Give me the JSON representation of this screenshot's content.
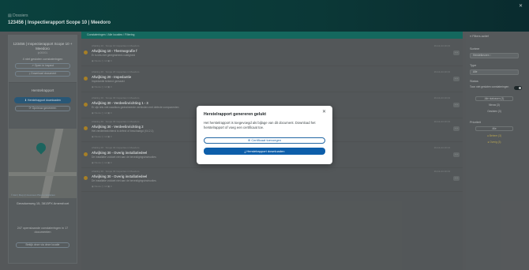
{
  "header": {
    "crumb": "▤ Dossiers",
    "title": "123456 | Inspectierapport Scope 10 | Meedoro"
  },
  "left": {
    "card_title": "123456 | Inspectierapport Scope 10 + Meedoro",
    "card_sub": "ip00001",
    "findings_count": "4 niet gesloten constateringen",
    "open_button": "↗ Open in inspect",
    "download_button": "⤓ Download document",
    "herstel_heading": "Herstelrapport",
    "herstel_download": "⬇ Herstelrapport downloaden",
    "opnieuw": "⟳ Opnieuw genereren",
    "map_attr": "© Esri | Map (c) Hoorveen Plus to mindstraat",
    "address": "Geradumweg 15, 3813PX Amersfoort",
    "count_text": "247 openstaande constateringen in 17 documenten",
    "bottom_button": "Bekijk deze via deze locatie"
  },
  "tabbar": {
    "label": "Constateringen / Alle locaties / Filtering"
  },
  "findings": [
    {
      "meta": "Afdeling 10 · Scope 10 inspecties in Meedoro",
      "title": "Afwijking 10 - Thermografie f",
      "desc": "Er is iets niet geregistreerd-vuldigheid",
      "foot": "◉ Nieuw   ◷ 1d   ▣ 0",
      "date": "16-12-24 10:13",
      "dot": "#b58a2a"
    },
    {
      "meta": "Afdeling 20 · Scope 20 inspecties in Meedoro",
      "title": "Afwijking 20 - Impedantie",
      "desc": "Impedantie bekend gemaakt",
      "foot": "◉ Nieuw   ◷ 1d   ▣ 0",
      "date": "16-12-24 10:13",
      "dot": "#b58a2a"
    },
    {
      "meta": "Afdeling 30 · Scope 30 inspecties in Meedoro",
      "title": "Afwijking 30 - Verdeelinrichting 1 - 3",
      "desc": "Er zijn iets niet naadloos gedraineerde verbinden met defecte componenten",
      "foot": "◉ Nieuw   ◷ 1d   ▣ 0",
      "date": "16-12-24 10:13",
      "dot": "#b58a2a"
    },
    {
      "meta": "Afdeling 30 · Scope 30 inspecties in Meedoro",
      "title": "Afwijking 30 - Verdeelinrichting 2",
      "desc": "Het verdeelinrichtend is defect of beschadigd (X4.2.1)",
      "foot": "◉ Nieuw   ◷ 1d   ▣ 0",
      "date": "16-12-24 10:13",
      "dot": "#b58a2a"
    },
    {
      "meta": "Afdeling 30 · Scope 30 inspecties in Meedoro",
      "title": "Afwijking 30 - Overig installatiedeel",
      "desc": "De installatie voldoet niet aan de bevestigingsinstructies",
      "foot": "◉ Nieuw   ◷ 1d   ▣ 0",
      "date": "16-12-24 10:13",
      "dot": "#b58a2a"
    },
    {
      "meta": "Afdeling 30 · Scope 30 inspecties in Meedoro",
      "title": "Afwijking 30 - Overig installatiedeel",
      "desc": "De installatie voldoet niet aan de bevestigingsinstructies",
      "foot": "◉ Nieuw   ◷ 1d   ▣ 0",
      "date": "16-12-24 10:13",
      "dot": "#b58a2a"
    }
  ],
  "right": {
    "filter_title": "≡ Filters actief",
    "sorteer": "Sorteer",
    "sorteer_value": "Herstelkeuren ↑",
    "type": "Type",
    "type_value": "Alle",
    "status": "Status",
    "status_text": "Toon niet gesloten constateringen",
    "alle_btn": "Alle statussen (3)",
    "nieuw_btn": "Nieuw (3)",
    "gesloten_btn": "Gesloten (3)",
    "prioriteit": "Prioriteit",
    "prio_alle": "Alle",
    "prio_1": "● Beheer (3)",
    "prio_2": "● Overig (3)"
  },
  "modal": {
    "title": "Herstelrapport genereren gelukt",
    "text": "Het herstelrapport is toegevoegd als bijlage van dit document. Download het herstelrapport of voeg een certificaat toe.",
    "btn_certificate": "⊕ Certificaat toevoegen",
    "btn_download": "⤓ Herstelrapport downloaden"
  }
}
